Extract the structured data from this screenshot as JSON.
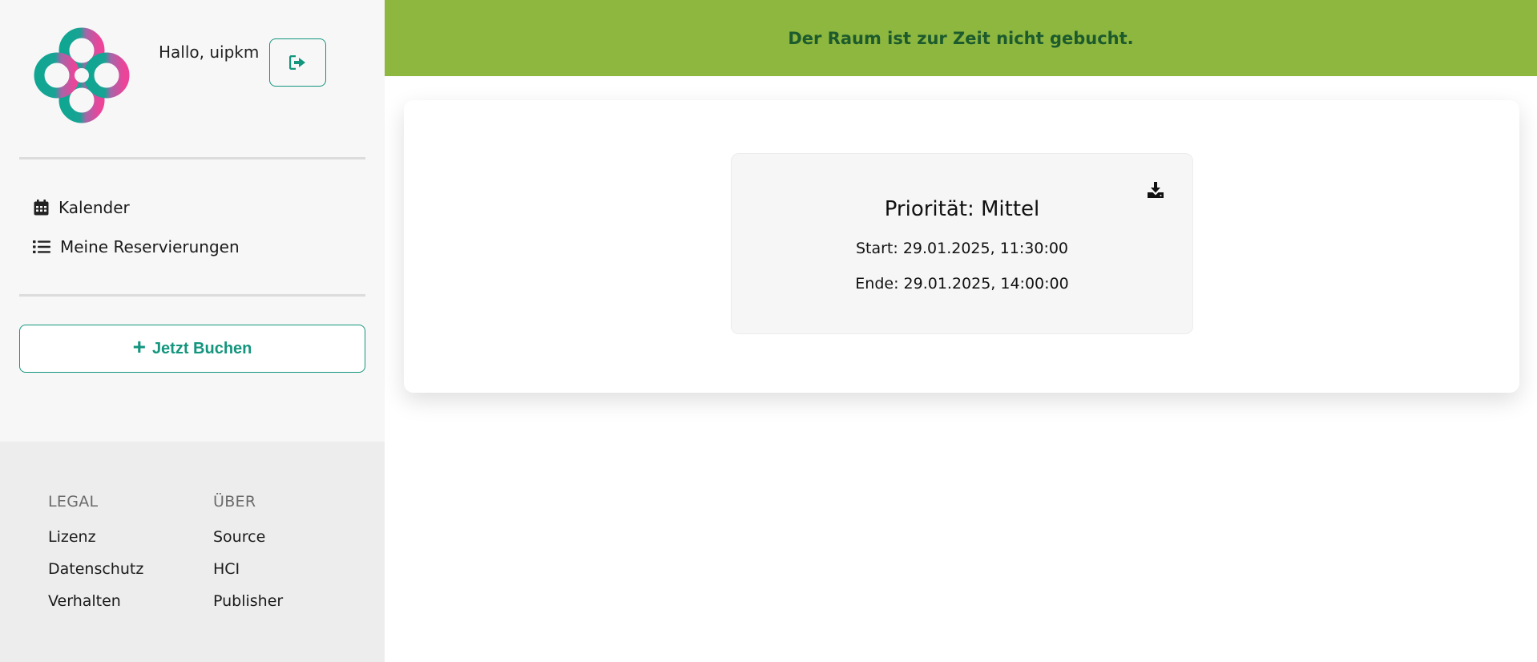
{
  "user": {
    "greeting": "Hallo, uipkm"
  },
  "icons": {
    "logo": "clover-logo",
    "logout": "sign-out-icon",
    "calendar": "calendar-icon",
    "list": "list-icon",
    "plus": "plus-icon",
    "download": "download-icon"
  },
  "colors": {
    "accent": "#13957e",
    "banner_bg": "#8db73e",
    "banner_text": "#1d5b2e",
    "logo_teal": "#13a596",
    "logo_pink": "#e6489c"
  },
  "nav": {
    "items": [
      {
        "label": "Kalender"
      },
      {
        "label": "Meine Reservierungen"
      }
    ]
  },
  "actions": {
    "book_now": "Jetzt Buchen",
    "book_icon": "+"
  },
  "footer": {
    "legal": {
      "heading": "LEGAL",
      "links": [
        "Lizenz",
        "Datenschutz",
        "Verhalten"
      ]
    },
    "about": {
      "heading": "ÜBER",
      "links": [
        "Source",
        "HCI",
        "Publisher"
      ]
    }
  },
  "status": {
    "message": "Der Raum ist zur Zeit nicht gebucht."
  },
  "booking": {
    "priority": "Priorität: Mittel",
    "start": "Start: 29.01.2025, 11:30:00",
    "end": "Ende: 29.01.2025, 14:00:00"
  }
}
